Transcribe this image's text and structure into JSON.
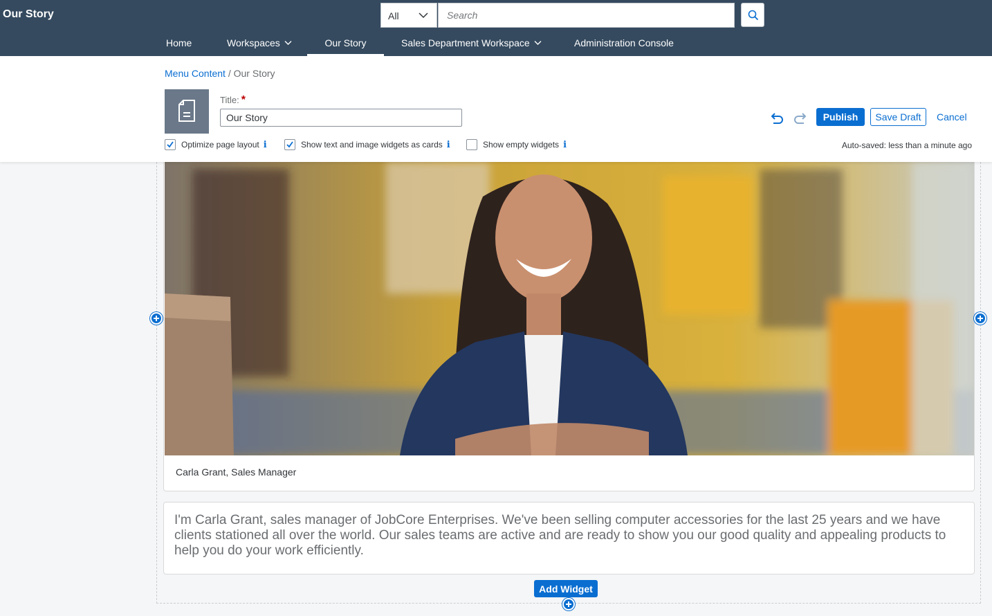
{
  "app": {
    "title": "Our Story"
  },
  "search": {
    "scope": "All",
    "placeholder": "Search"
  },
  "nav": {
    "home": "Home",
    "workspaces": "Workspaces",
    "our_story": "Our Story",
    "sales_workspace": "Sales Department Workspace",
    "admin_console": "Administration Console"
  },
  "breadcrumb": {
    "parent": "Menu Content",
    "separator": "/",
    "current": "Our Story"
  },
  "editor": {
    "title_label": "Title:",
    "required_mark": "*",
    "title_value": "Our Story",
    "publish": "Publish",
    "save_draft": "Save Draft",
    "cancel": "Cancel",
    "options": [
      {
        "label": "Optimize page layout",
        "checked": true
      },
      {
        "label": "Show text and image widgets as cards",
        "checked": true
      },
      {
        "label": "Show empty widgets",
        "checked": false
      }
    ],
    "info_glyph": "i",
    "autosave": "Auto-saved: less than a minute ago"
  },
  "content": {
    "image_caption": "Carla Grant, Sales Manager",
    "paragraph": "I'm Carla Grant, sales manager of JobCore Enterprises. We've been selling computer accessories for the last 25 years and we have clients stationed all over the world. Our sales teams are active and are ready to show you our good quality and appealing products to help you do your work efficiently.",
    "add_widget": "Add Widget"
  },
  "colors": {
    "shell": "#354a5f",
    "accent": "#0a6ed1",
    "page_icon_bg": "#6a7889",
    "required": "#bb0000"
  },
  "icons": {
    "search": "search-icon",
    "chevron": "chevron-down-icon",
    "page": "document-icon",
    "undo": "undo-icon",
    "redo": "redo-icon",
    "add": "plus-icon",
    "info": "info-icon"
  }
}
